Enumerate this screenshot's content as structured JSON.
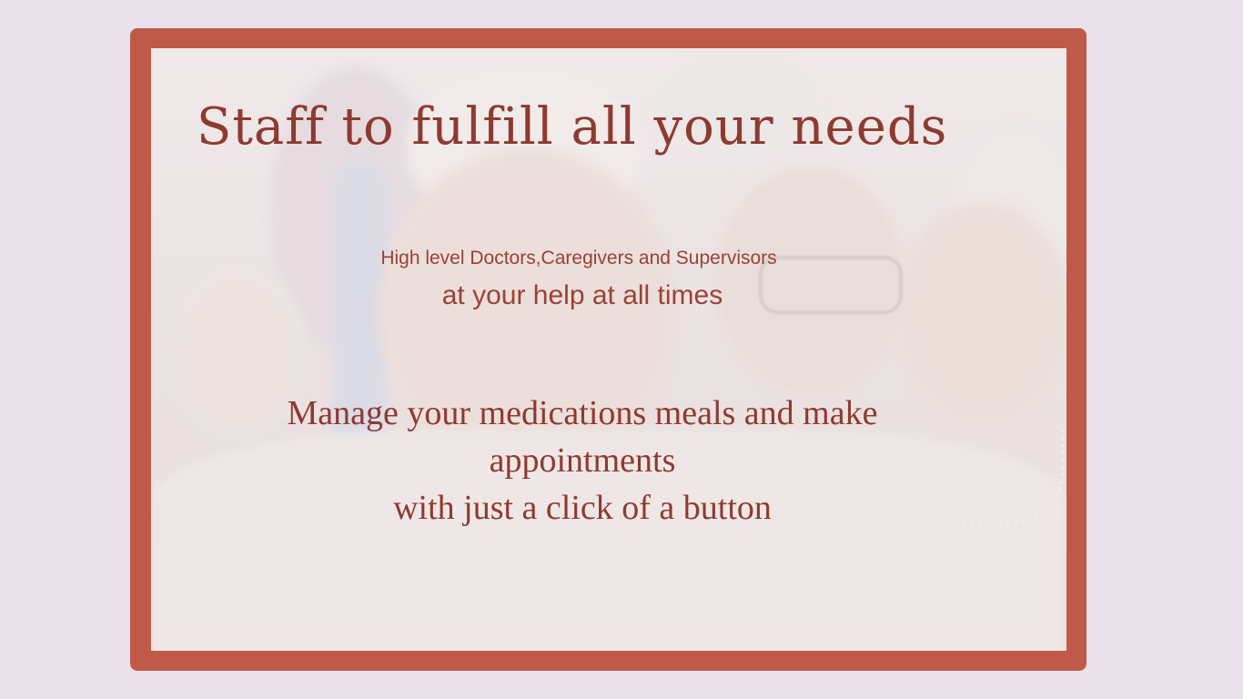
{
  "slide": {
    "headline": "Staff to fulfill all your needs",
    "subtitle_line1": "High level Doctors,Caregivers and Supervisors",
    "subtitle_line2": "at your help at all times",
    "body_line1": "Manage your medications meals and make",
    "body_line2": "appointments",
    "body_line3": "with just a click of a button"
  },
  "colors": {
    "page_background": "#e9e2ea",
    "frame": "#c05a48",
    "text": "#8e3a31"
  }
}
